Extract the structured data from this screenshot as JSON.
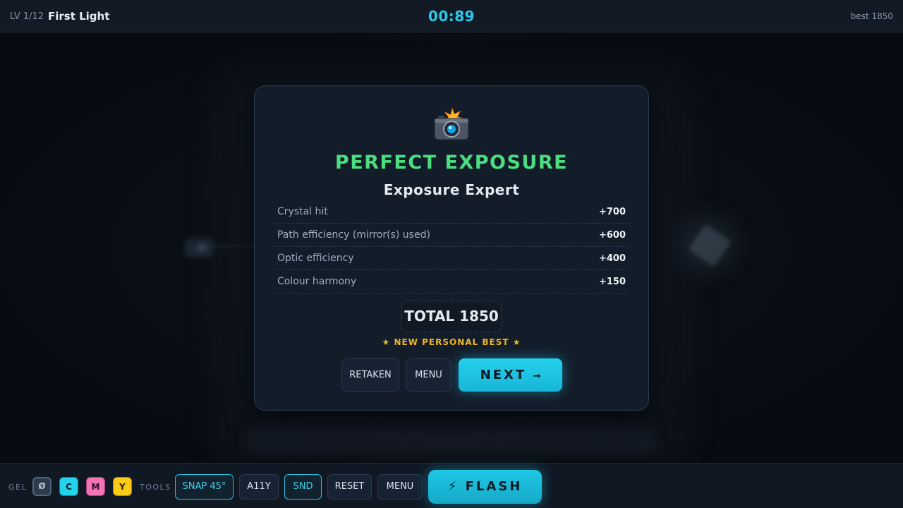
{
  "header": {
    "level": "LV 1/12",
    "level_name": "First Light",
    "timer": "00:89",
    "best": "best 1850"
  },
  "modal": {
    "icon": "camera-flash-icon",
    "title": "PERFECT EXPOSURE",
    "subtitle": "Exposure Expert",
    "score_rows": [
      {
        "label": "Crystal hit",
        "value": "+700"
      },
      {
        "label": "Path efficiency (mirror(s) used)",
        "value": "+600"
      },
      {
        "label": "Optic efficiency",
        "value": "+400"
      },
      {
        "label": "Colour harmony",
        "value": "+150"
      }
    ],
    "total": "TOTAL 1850",
    "personal_best": "★ NEW PERSONAL BEST ★",
    "buttons": {
      "retaken": "RETAKEN",
      "menu": "MENU",
      "next": "NEXT",
      "next_arrow": "→"
    }
  },
  "toolbar": {
    "gel_label": "GEL",
    "gels": [
      "Ø",
      "C",
      "M",
      "Y"
    ],
    "tools_label": "TOOLS",
    "snap": "SNAP 45°",
    "a11y": "A11Y",
    "snd": "SND",
    "reset": "RESET",
    "menu": "MENU",
    "flash_icon": "⚡",
    "flash": "FLASH"
  },
  "colors": {
    "accent": "#22d3ee",
    "success": "#4ade80",
    "gold": "#f0b429",
    "gel_cyan": "#22d3ee",
    "gel_magenta": "#f472b6",
    "gel_yellow": "#facc15"
  }
}
